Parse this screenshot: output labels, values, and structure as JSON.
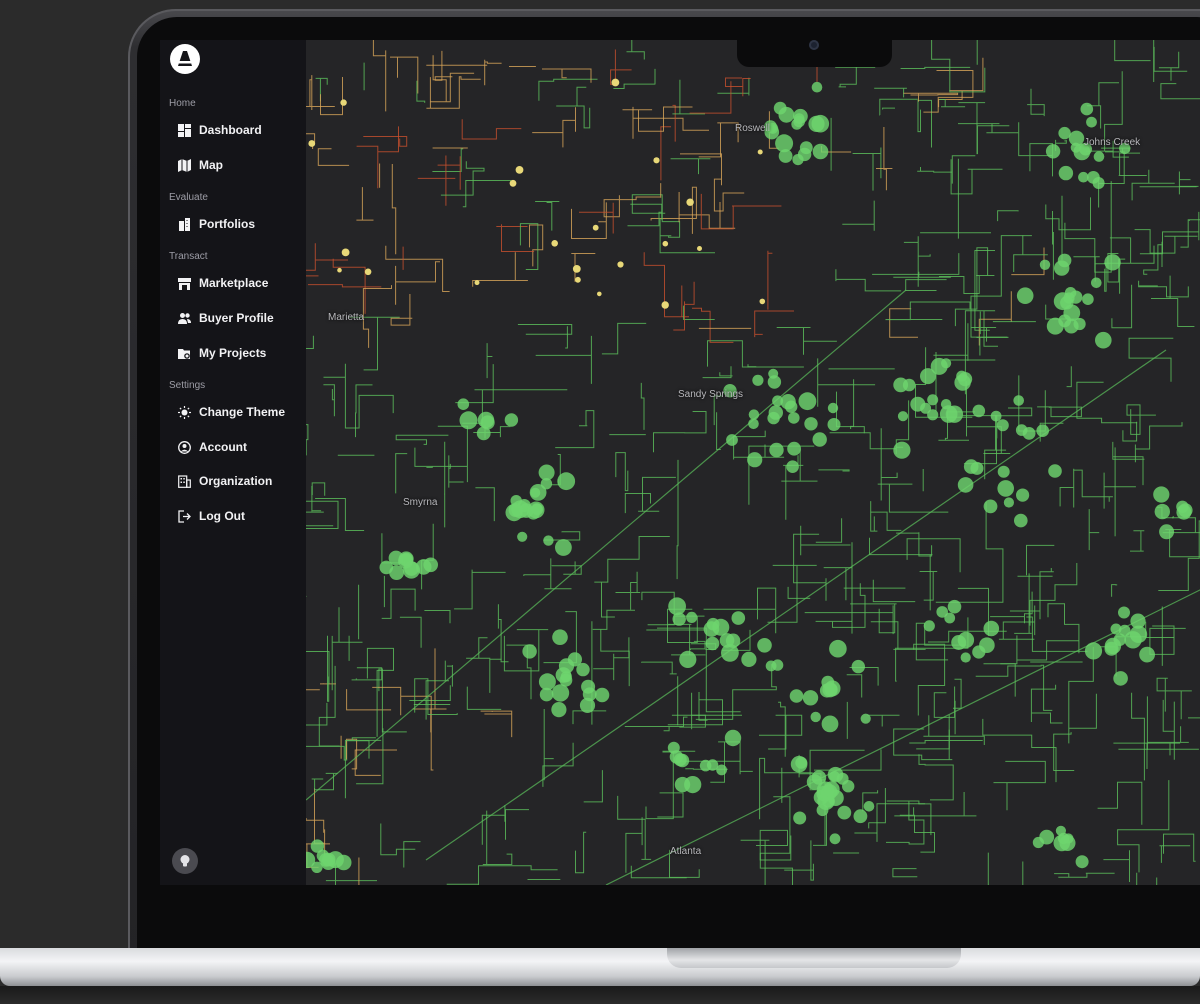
{
  "app": {
    "colors": {
      "sidebar_bg": "#141418",
      "map_bg": "#252527",
      "grid_good": "#5cc25c",
      "grid_fair": "#d9a65a",
      "grid_poor": "#c8502e",
      "accent_marker": "#6ed46e"
    }
  },
  "sidebar": {
    "logo_icon": "brand-logo-icon",
    "sections": [
      {
        "title": "Home",
        "items": [
          {
            "label": "Dashboard",
            "icon": "dashboard-icon"
          },
          {
            "label": "Map",
            "icon": "map-icon"
          }
        ]
      },
      {
        "title": "Evaluate",
        "items": [
          {
            "label": "Portfolios",
            "icon": "buildings-icon"
          }
        ]
      },
      {
        "title": "Transact",
        "items": [
          {
            "label": "Marketplace",
            "icon": "store-icon"
          },
          {
            "label": "Buyer Profile",
            "icon": "users-icon"
          },
          {
            "label": "My Projects",
            "icon": "folder-gear-icon"
          }
        ]
      },
      {
        "title": "Settings",
        "items": [
          {
            "label": "Change Theme",
            "icon": "sun-icon"
          },
          {
            "label": "Account",
            "icon": "user-circle-icon"
          },
          {
            "label": "Organization",
            "icon": "office-icon"
          },
          {
            "label": "Log Out",
            "icon": "logout-icon"
          }
        ]
      }
    ],
    "help_icon": "lightbulb-icon"
  },
  "map": {
    "cities": [
      "Roswell",
      "Johns Creek",
      "Marietta",
      "Sandy Springs",
      "Smyrna",
      "Atlanta"
    ]
  }
}
